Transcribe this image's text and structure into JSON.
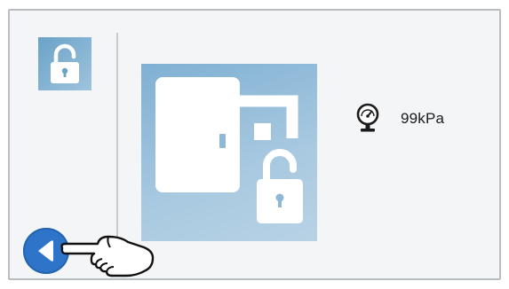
{
  "status": {
    "lock_icon": "unlocked-padlock-icon",
    "door_icon": "door-unlocked-icon"
  },
  "pressure": {
    "icon": "pressure-gauge-icon",
    "value": "99kPa"
  },
  "navigation": {
    "back_icon": "back-arrow-icon",
    "hint_icon": "pointing-hand-icon"
  },
  "colors": {
    "accent_blue": "#2e74c9",
    "tile_blue": "#7fb0d3",
    "screen_bg": "#f4f5f7"
  }
}
